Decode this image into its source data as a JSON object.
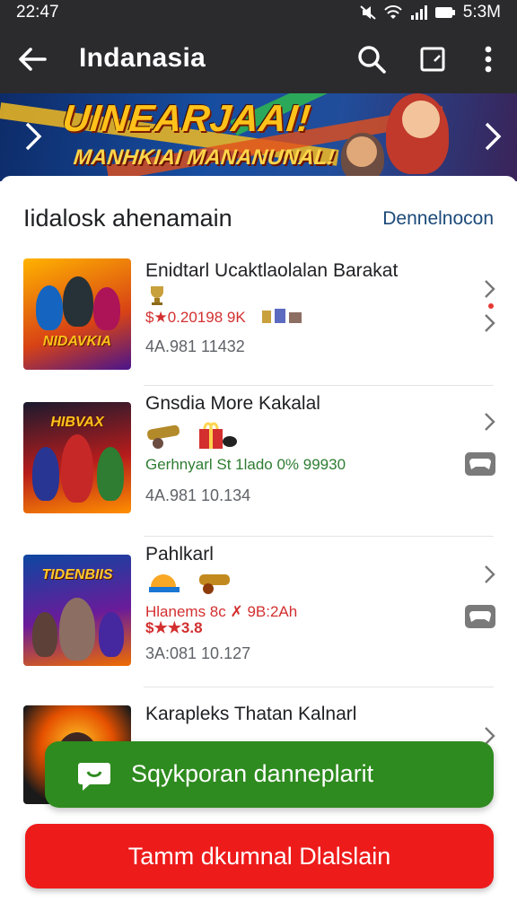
{
  "status_bar": {
    "time": "22:47",
    "clock": "5:3M"
  },
  "app_bar": {
    "title": "Indanasia",
    "icons": [
      "back-arrow-icon",
      "search-icon",
      "crop-icon",
      "more-vert-icon"
    ]
  },
  "banner": {
    "headline": "UINEARJAAI!",
    "subtitle": "MANHKIAI MANANUNAL!",
    "colors": {
      "text": "#ffc21a",
      "bg": "#174da0"
    }
  },
  "section": {
    "title": "Iidalosk ahenamain",
    "link": "Dennelnocon"
  },
  "items": [
    {
      "thumb_text": "NIDAVKIA",
      "name": "Enidtarl Ucaktlaolalan Barakat",
      "price": "$★0.20198 9K",
      "meta": "4A.981 11432",
      "price_color": "#d32f2f"
    },
    {
      "thumb_text": "HIBVAX",
      "name": "Gnsdia More Kakalal",
      "price": "Gerhnyarl St 1lado 0% 99930",
      "meta": "4A.981 10.134",
      "price_color": "#2e7d32"
    },
    {
      "thumb_text": "TIDENBIIS",
      "name": "Pahlkarl",
      "price": "Hlanems 8c ✗ 9B:2Ah",
      "price2": "$★★3.8",
      "meta": "3A:081 10.127",
      "price_color": "#d32f2f"
    },
    {
      "thumb_text": "",
      "name": "Karapleks Thatan Kalnarl",
      "meta": "",
      "price_color": "#d32f2f"
    }
  ],
  "toast": {
    "label": "Sqykporan danneplarit",
    "icon": "chat-bubble-icon",
    "color": "#2e8b1f"
  },
  "cta": {
    "label": "Tamm dkumnal Dlalslain",
    "color": "#ee1b1b"
  }
}
